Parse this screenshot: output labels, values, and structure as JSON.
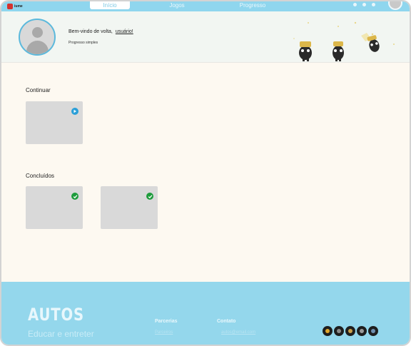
{
  "nav": {
    "brand": "iume",
    "tabs": [
      {
        "label": "Início",
        "active": true
      },
      {
        "label": "Jogos",
        "active": false
      },
      {
        "label": "Progresso",
        "active": false
      }
    ]
  },
  "header": {
    "welcome": "Bem-vindo de volta,",
    "username": "usuário!",
    "progress": "Progresso simples"
  },
  "main": {
    "continue_title": "Continuar",
    "completed_title": "Concluídos"
  },
  "footer": {
    "brand": "AUTOS",
    "tagline": "Educar e entreter",
    "columns": [
      {
        "title": "Parcerias",
        "link": "Parceiros"
      },
      {
        "title": "Contato",
        "link": "autos@email.com"
      }
    ],
    "socials": [
      "facebook-icon",
      "twitter-icon",
      "instagram-icon",
      "youtube-icon",
      "whatsapp-icon"
    ]
  },
  "colors": {
    "accent": "#94d7ec",
    "background": "#fdf9f1",
    "play": "#2a9fd8",
    "check": "#1e9c3c"
  }
}
